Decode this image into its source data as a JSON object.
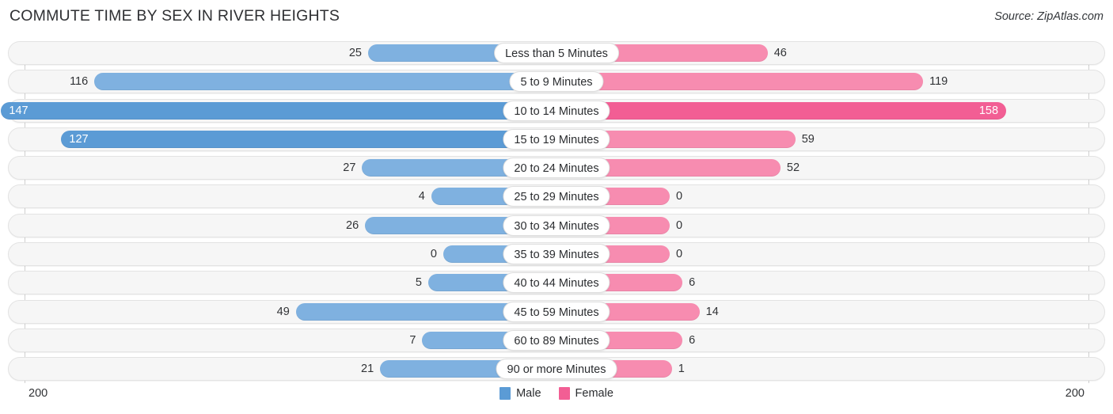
{
  "header": {
    "title": "COMMUTE TIME BY SEX IN RIVER HEIGHTS",
    "source": "Source: ZipAtlas.com"
  },
  "axis": {
    "left_max": "200",
    "right_max": "200"
  },
  "legend": {
    "items": [
      {
        "label": "Male",
        "color": "#5b9bd5"
      },
      {
        "label": "Female",
        "color": "#f25e94"
      }
    ]
  },
  "chart_data": {
    "type": "bar",
    "title": "COMMUTE TIME BY SEX IN RIVER HEIGHTS",
    "subtitle": "Source: ZipAtlas.com",
    "orientation": "horizontal-diverging",
    "xlabel": "",
    "ylabel": "",
    "xlim": [
      200,
      200
    ],
    "grid": false,
    "legend_position": "bottom-center",
    "categories": [
      "Less than 5 Minutes",
      "5 to 9 Minutes",
      "10 to 14 Minutes",
      "15 to 19 Minutes",
      "20 to 24 Minutes",
      "25 to 29 Minutes",
      "30 to 34 Minutes",
      "35 to 39 Minutes",
      "40 to 44 Minutes",
      "45 to 59 Minutes",
      "60 to 89 Minutes",
      "90 or more Minutes"
    ],
    "series": [
      {
        "name": "Male",
        "color": "#5b9bd5",
        "values": [
          25,
          116,
          147,
          127,
          27,
          4,
          26,
          0,
          5,
          49,
          7,
          21
        ]
      },
      {
        "name": "Female",
        "color": "#f25e94",
        "values": [
          46,
          119,
          158,
          59,
          52,
          0,
          0,
          0,
          6,
          14,
          6,
          1
        ]
      }
    ],
    "rows": [
      {
        "label": "Less than 5 Minutes",
        "male": 25,
        "female": 46,
        "male_label": "25",
        "female_label": "46",
        "male_inside": false,
        "female_inside": false
      },
      {
        "label": "5 to 9 Minutes",
        "male": 116,
        "female": 119,
        "male_label": "116",
        "female_label": "119",
        "male_inside": false,
        "female_inside": false
      },
      {
        "label": "10 to 14 Minutes",
        "male": 147,
        "female": 158,
        "male_label": "147",
        "female_label": "158",
        "male_inside": true,
        "female_inside": true
      },
      {
        "label": "15 to 19 Minutes",
        "male": 127,
        "female": 59,
        "male_label": "127",
        "female_label": "59",
        "male_inside": true,
        "female_inside": false
      },
      {
        "label": "20 to 24 Minutes",
        "male": 27,
        "female": 52,
        "male_label": "27",
        "female_label": "52",
        "male_inside": false,
        "female_inside": false
      },
      {
        "label": "25 to 29 Minutes",
        "male": 4,
        "female": 0,
        "male_label": "4",
        "female_label": "0",
        "male_inside": false,
        "female_inside": false
      },
      {
        "label": "30 to 34 Minutes",
        "male": 26,
        "female": 0,
        "male_label": "26",
        "female_label": "0",
        "male_inside": false,
        "female_inside": false
      },
      {
        "label": "35 to 39 Minutes",
        "male": 0,
        "female": 0,
        "male_label": "0",
        "female_label": "0",
        "male_inside": false,
        "female_inside": false
      },
      {
        "label": "40 to 44 Minutes",
        "male": 5,
        "female": 6,
        "male_label": "5",
        "female_label": "6",
        "male_inside": false,
        "female_inside": false
      },
      {
        "label": "45 to 59 Minutes",
        "male": 49,
        "female": 14,
        "male_label": "49",
        "female_label": "14",
        "male_inside": false,
        "female_inside": false
      },
      {
        "label": "60 to 89 Minutes",
        "male": 7,
        "female": 6,
        "male_label": "7",
        "female_label": "6",
        "male_inside": false,
        "female_inside": false
      },
      {
        "label": "90 or more Minutes",
        "male": 21,
        "female": 1,
        "male_label": "21",
        "female_label": "1",
        "male_inside": false,
        "female_inside": false
      }
    ]
  }
}
